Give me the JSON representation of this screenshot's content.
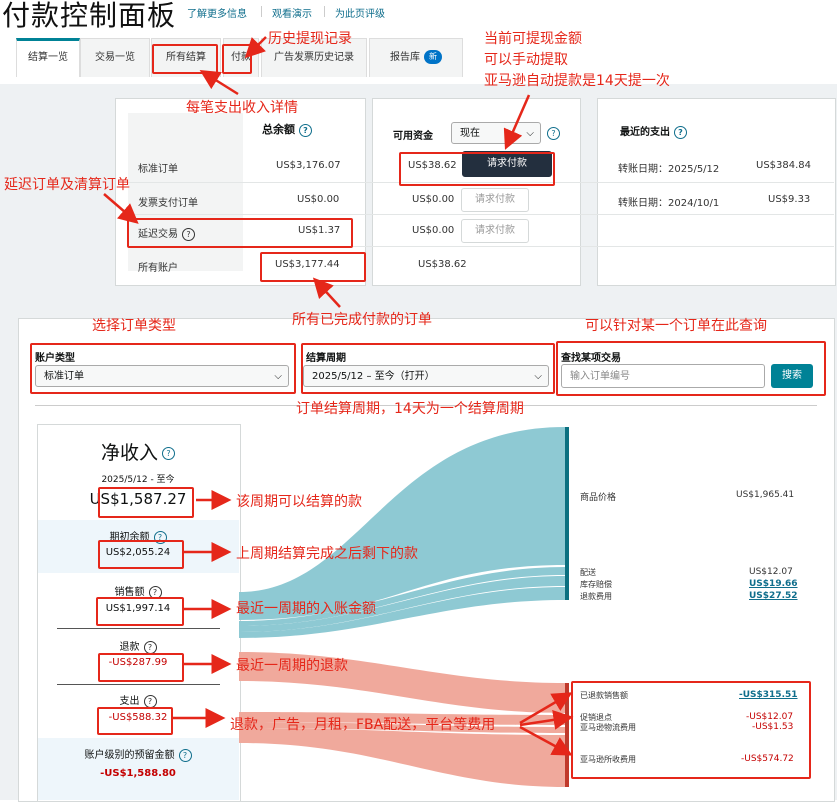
{
  "header": {
    "title": "付款控制面板",
    "links": [
      "了解更多信息",
      "观看演示",
      "为此页评级"
    ]
  },
  "tabs": [
    {
      "label": "结算一览"
    },
    {
      "label": "交易一览"
    },
    {
      "label": "所有结算"
    },
    {
      "label": "付款"
    },
    {
      "label": "广告发票历史记录"
    },
    {
      "label": "报告库"
    }
  ],
  "tabs_badge": "新",
  "summary": {
    "col_total": "总余额",
    "col_available": "可用资金",
    "available_select": "现在",
    "col_recent": "最近的支出",
    "rows": [
      {
        "label": "标准订单",
        "total": "US$3,176.07",
        "available": "US$38.62",
        "button": "请求付款"
      },
      {
        "label": "发票支付订单",
        "total": "US$0.00",
        "available": "US$0.00",
        "button": "请求付款"
      },
      {
        "label": "延迟交易",
        "total": "US$1.37",
        "available": "US$0.00",
        "button": "请求付款"
      },
      {
        "label": "所有账户",
        "total": "US$3,177.44",
        "available": "US$38.62"
      }
    ],
    "recent": [
      {
        "label": "转账日期：2025/5/12",
        "amount": "US$384.84"
      },
      {
        "label": "转账日期：2024/10/1",
        "amount": "US$9.33"
      }
    ]
  },
  "filters": {
    "account_type_label": "账户类型",
    "account_type_value": "标准订单",
    "period_label": "结算周期",
    "period_value": "2025/5/12 – 至今（打开）",
    "search_label": "查找某项交易",
    "search_placeholder": "输入订单编号",
    "search_button": "搜索"
  },
  "net": {
    "title": "净收入",
    "date": "2025/5/12 - 至今",
    "amount": "US$1,587.27",
    "items": [
      {
        "label": "期初余额",
        "amount": "US$2,055.24"
      },
      {
        "label": "销售额",
        "amount": "US$1,997.14"
      },
      {
        "label": "退款",
        "amount": "-US$287.99"
      },
      {
        "label": "支出",
        "amount": "-US$588.32"
      },
      {
        "label": "账户级别的预留金额",
        "amount": "-US$1,588.80"
      }
    ]
  },
  "flows": {
    "income": [
      {
        "label": "商品价格",
        "amount": "US$1,965.41"
      },
      {
        "label": "配送",
        "amount": "US$12.07"
      },
      {
        "label": "库存赔偿",
        "amount": "US$19.66"
      },
      {
        "label": "退款费用",
        "amount": "US$27.52"
      }
    ],
    "expense": [
      {
        "label": "已退款销售额",
        "amount": "-US$315.51"
      },
      {
        "label": "促销退点",
        "amount": "-US$12.07"
      },
      {
        "label": "亚马逊物流费用",
        "amount": "-US$1.53"
      },
      {
        "label": "亚马逊所收费用",
        "amount": "-US$574.72"
      }
    ]
  },
  "annotations": {
    "history": "历史提现记录",
    "withdraw": [
      "当前可提现金额",
      "可以手动提取",
      "亚马逊自动提款是14天提一次"
    ],
    "detail": "每笔支出收入详情",
    "delayed": "延迟订单及清算订单",
    "select_type": "选择订单类型",
    "completed": "所有已完成付款的订单",
    "query": "可以针对某一个订单在此查询",
    "period": "订单结算周期，14天为一个结算周期",
    "net": "该周期可以结算的款",
    "opening": "上周期结算完成之后剩下的款",
    "sales": "最近一周期的入账金额",
    "refund": "最近一周期的退款",
    "expense": "退款，广告，月租，FBA配送，平台等费用"
  },
  "colors": {
    "accent": "#008296",
    "annotation": "#e5271a",
    "income_flow": "#8ec9d3",
    "expense_flow": "#f0a99c"
  }
}
